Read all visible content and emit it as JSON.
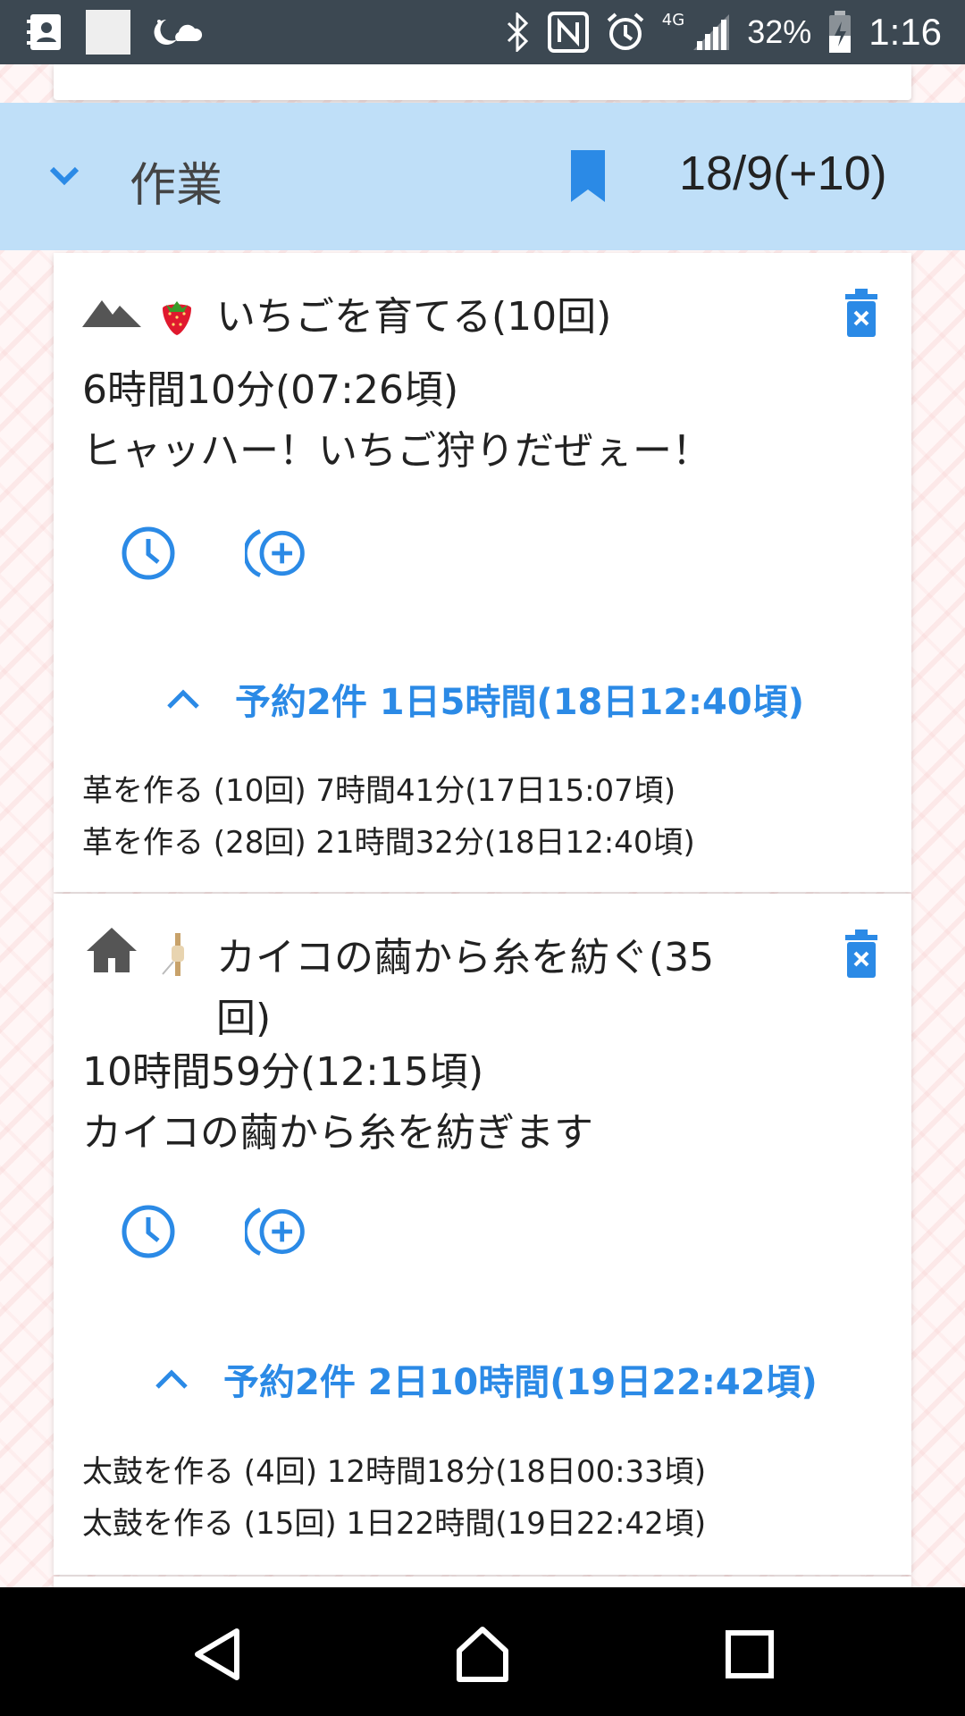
{
  "status_bar": {
    "network_badge": "4G",
    "battery": "32%",
    "time": "1:16"
  },
  "section": {
    "title": "作業",
    "count": "18/9(+10)"
  },
  "tasks": [
    {
      "title": "いちごを育てる(10回)",
      "duration": "6時間10分(07:26頃)",
      "description": "ヒャッハー！いちご狩りだぜぇー！",
      "reservation_summary": "予約2件 1日5時間(18日12:40頃)",
      "reservations": [
        "革を作る (10回) 7時間41分(17日15:07頃)",
        "革を作る (28回) 21時間32分(18日12:40頃)"
      ]
    },
    {
      "title": "カイコの繭から糸を紡ぐ(35回)",
      "duration": "10時間59分(12:15頃)",
      "description": "カイコの繭から糸を紡ぎます",
      "reservation_summary": "予約2件 2日10時間(19日22:42頃)",
      "reservations": [
        "太鼓を作る (4回) 12時間18分(18日00:33頃)",
        "太鼓を作る (15回) 1日22時間(19日22:42頃)"
      ]
    }
  ],
  "icons": {
    "accent_color": "#2b8ae6",
    "header_bg": "#bfdff8",
    "task1_type": "mountain-icon",
    "task1_item": "strawberry-icon",
    "task2_type": "home-icon",
    "task2_item": "spindle-icon"
  }
}
